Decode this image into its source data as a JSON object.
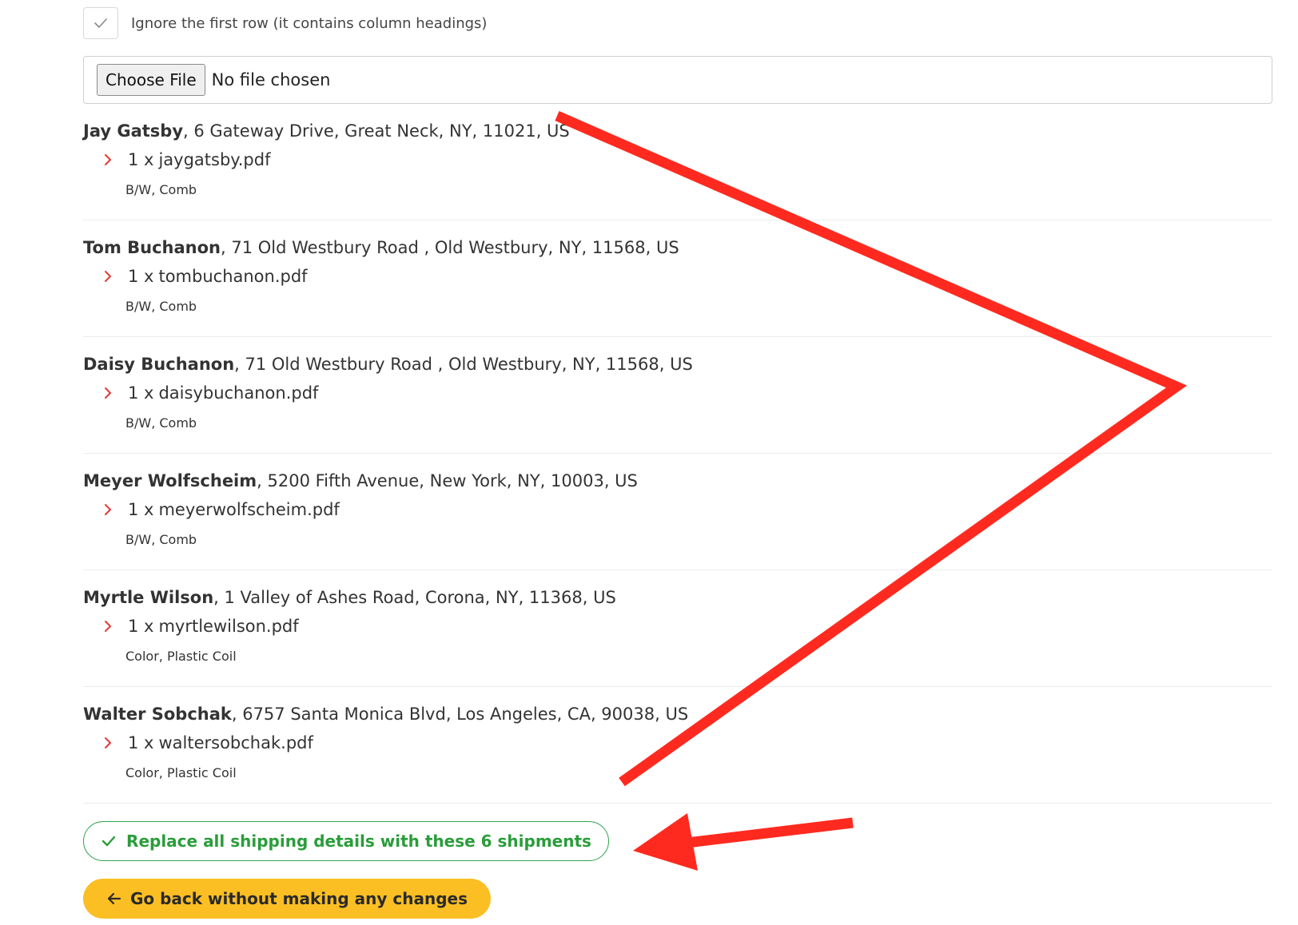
{
  "options": {
    "ignore_first_row_label": "Ignore the first row (it contains column headings)",
    "ignore_first_row_checked": true
  },
  "file_input": {
    "button_label": "Choose File",
    "status": "No file chosen"
  },
  "shipments": [
    {
      "name": "Jay Gatsby",
      "address": ", 6 Gateway Drive, Great Neck, NY, 11021, US",
      "quantity": "1 x",
      "file": "jaygatsby.pdf",
      "options": "B/W, Comb"
    },
    {
      "name": "Tom Buchanon",
      "address": ", 71 Old Westbury Road , Old Westbury, NY, 11568, US",
      "quantity": "1 x",
      "file": "tombuchanon.pdf",
      "options": "B/W, Comb"
    },
    {
      "name": "Daisy Buchanon",
      "address": ", 71 Old Westbury Road , Old Westbury, NY, 11568, US",
      "quantity": "1 x",
      "file": "daisybuchanon.pdf",
      "options": "B/W, Comb"
    },
    {
      "name": "Meyer Wolfscheim",
      "address": ", 5200 Fifth Avenue, New York, NY, 10003, US",
      "quantity": "1 x",
      "file": "meyerwolfscheim.pdf",
      "options": "B/W, Comb"
    },
    {
      "name": "Myrtle Wilson",
      "address": ", 1 Valley of Ashes Road, Corona, NY, 11368, US",
      "quantity": "1 x",
      "file": "myrtlewilson.pdf",
      "options": "Color, Plastic Coil"
    },
    {
      "name": "Walter Sobchak",
      "address": ", 6757 Santa Monica Blvd, Los Angeles, CA, 90038, US",
      "quantity": "1 x",
      "file": "waltersobchak.pdf",
      "options": "Color, Plastic Coil"
    }
  ],
  "actions": {
    "replace_label": "Replace all shipping details with these 6 shipments",
    "back_label": "Go back without making any changes"
  },
  "colors": {
    "accent_green": "#2a9d3a",
    "button_yellow": "#fbbf24",
    "chevron_red": "#e53935",
    "annotation_red": "#ff2a1f"
  },
  "icons": {
    "checkbox": "checkmark-icon",
    "item_bullet": "chevron-right-icon",
    "replace": "checkmark-icon",
    "back": "arrow-left-icon"
  }
}
